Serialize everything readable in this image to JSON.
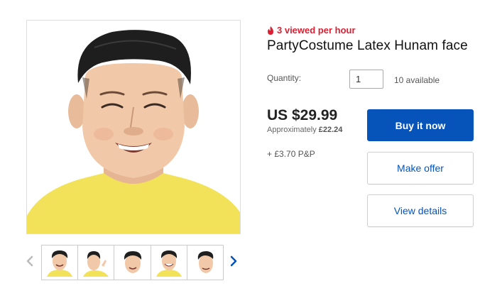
{
  "listing": {
    "viewed_text": "3 viewed per hour",
    "title": "PartyCostume Latex Hunam face"
  },
  "quantity": {
    "label": "Quantity:",
    "value": "1",
    "available": "10 available"
  },
  "pricing": {
    "price": "US $29.99",
    "approx_prefix": "Approximately",
    "approx_value": "£22.24",
    "postage": "+ £3.70 P&P"
  },
  "actions": {
    "buy_now": "Buy it now",
    "make_offer": "Make offer",
    "view_details": "View details"
  },
  "gallery": {
    "thumbnail_count": 5,
    "prev_icon": "chevron-left-icon",
    "next_icon": "chevron-right-icon"
  },
  "colors": {
    "accent_blue": "#0654ba",
    "viewed_red": "#dd1e31",
    "shirt_yellow": "#f2e25a",
    "hair_black": "#1e1e1e",
    "skin": "#f1c9a9"
  }
}
